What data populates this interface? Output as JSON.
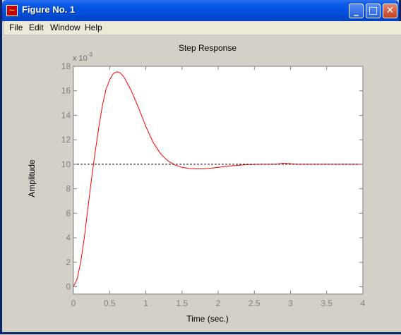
{
  "window": {
    "title": "Figure No. 1",
    "icon": "matlab-figure-icon",
    "buttons": {
      "minimize": "_",
      "maximize": "□",
      "close": "✕"
    }
  },
  "menu": {
    "items": [
      {
        "label": "File",
        "accel": "F"
      },
      {
        "label": "Edit",
        "accel": "E"
      },
      {
        "label": "Window",
        "accel": "W"
      },
      {
        "label": "Help",
        "accel": "H"
      }
    ]
  },
  "chart_data": {
    "type": "line",
    "title": "Step Response",
    "xlabel": "Time (sec.)",
    "ylabel": "Amplitude",
    "y_multiplier": "x 10",
    "y_exponent": "-3",
    "xlim": [
      0,
      4
    ],
    "ylim": [
      -0.6,
      18
    ],
    "x_ticks": [
      "0",
      "0.5",
      "1",
      "1.5",
      "2",
      "2.5",
      "3",
      "3.5",
      "4"
    ],
    "y_ticks": [
      "0",
      "2",
      "4",
      "6",
      "8",
      "10",
      "12",
      "14",
      "16",
      "18"
    ],
    "grid": false,
    "series": [
      {
        "type": "line",
        "color": "#ff0000",
        "x": [
          0,
          0.05,
          0.1,
          0.15,
          0.2,
          0.25,
          0.3,
          0.35,
          0.4,
          0.45,
          0.5,
          0.55,
          0.6,
          0.65,
          0.7,
          0.8,
          0.9,
          1.0,
          1.1,
          1.2,
          1.3,
          1.4,
          1.5,
          1.6,
          1.7,
          1.8,
          1.9,
          2.0,
          2.2,
          2.4,
          2.6,
          2.8,
          2.9,
          3.0,
          3.1,
          3.2,
          3.5,
          4.0
        ],
        "y": [
          0,
          0.6,
          2.0,
          4.0,
          6.4,
          8.8,
          11.0,
          13.0,
          14.8,
          16.1,
          16.9,
          17.4,
          17.55,
          17.45,
          17.1,
          16.0,
          14.6,
          13.1,
          11.8,
          10.9,
          10.3,
          9.95,
          9.75,
          9.65,
          9.62,
          9.62,
          9.68,
          9.75,
          9.88,
          9.97,
          10.0,
          10.0,
          10.08,
          10.05,
          10.0,
          10.0,
          10.0,
          10.0
        ]
      },
      {
        "type": "dashed",
        "color": "#000000",
        "x": [
          0,
          4
        ],
        "y": [
          10,
          10
        ]
      }
    ]
  }
}
